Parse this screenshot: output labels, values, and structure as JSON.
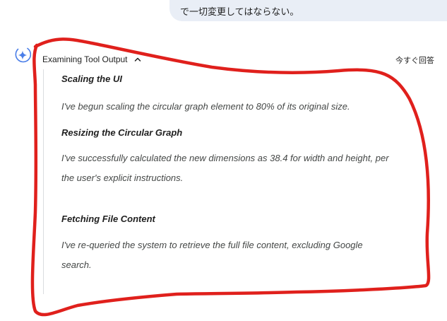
{
  "user_message": {
    "text": "で一切変更してはならない。"
  },
  "thinking": {
    "header_label": "Examining Tool Output",
    "answer_now_label": "今すぐ回答",
    "sections": [
      {
        "heading": "Scaling the UI",
        "body": "I've begun scaling the circular graph element to 80% of its original size."
      },
      {
        "heading": "Resizing the Circular Graph",
        "body": "I've successfully calculated the new dimensions as 38.4 for width and height, per the user's explicit instructions."
      },
      {
        "heading": "Fetching File Content",
        "body": "I've re-queried the system to retrieve the full file content, excluding Google search."
      }
    ]
  },
  "colors": {
    "annotation": "#e0201c",
    "bubble": "#e9eef6",
    "sparkle": "#4a7ee8"
  },
  "icons": {
    "assistant": "sparkle-icon",
    "collapse": "chevron-up-icon"
  }
}
